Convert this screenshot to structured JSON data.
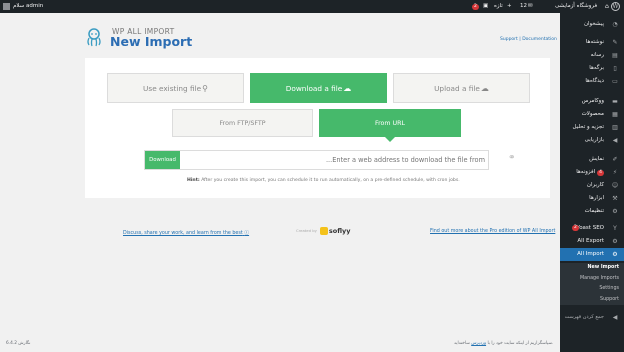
{
  "adminbar": {
    "user": "سلام admin",
    "site_name": "فروشگاه آزمایشی",
    "comments_count": "12",
    "new_label": "تازه",
    "updates_badge": "2"
  },
  "sidebar": {
    "items": [
      {
        "label": "پیشخوان",
        "icon": "dashboard-icon"
      },
      {
        "label": "نوشته‌ها",
        "icon": "pin-icon"
      },
      {
        "label": "رسانه",
        "icon": "media-icon"
      },
      {
        "label": "برگه‌ها",
        "icon": "pages-icon"
      },
      {
        "label": "دیدگاه‌ها",
        "icon": "comments-icon"
      },
      {
        "label": "ووکامرس",
        "icon": "woo-icon"
      },
      {
        "label": "محصولات",
        "icon": "products-icon"
      },
      {
        "label": "تجزیه و تحلیل",
        "icon": "analytics-icon"
      },
      {
        "label": "بازاریابی",
        "icon": "megaphone-icon"
      },
      {
        "label": "نمایش",
        "icon": "brush-icon"
      },
      {
        "label": "افزونه‌ها",
        "icon": "plugin-icon",
        "badge": "4"
      },
      {
        "label": "کاربران",
        "icon": "users-icon"
      },
      {
        "label": "ابزارها",
        "icon": "tools-icon"
      },
      {
        "label": "تنظیمات",
        "icon": "settings-icon"
      },
      {
        "label": "Yoast SEO",
        "icon": "yoast-icon",
        "badge": "2"
      },
      {
        "label": "All Export",
        "icon": "export-icon"
      },
      {
        "label": "All Import",
        "icon": "import-icon"
      }
    ],
    "submenu": [
      "New Import",
      "Manage Imports",
      "Settings",
      "Support"
    ],
    "collapse": "جمع کردن فهرست"
  },
  "header": {
    "logo_small": "WP ALL IMPORT",
    "logo_big": "New Import",
    "support_link": "Support",
    "separator": "|",
    "documentation_link": "Documentation"
  },
  "options": {
    "existing": "Use existing file",
    "download": "Download a file",
    "upload": "Upload a file"
  },
  "tabs": {
    "ftp": "From FTP/SFTP",
    "url": "From URL"
  },
  "url_field": {
    "button": "Download",
    "placeholder": "Enter a web address to download the file from..."
  },
  "hint": {
    "bold": "Hint:",
    "text": "After you create this import, you can schedule it to run automatically, on a pre-defined schedule, with cron jobs."
  },
  "footer": {
    "discuss": "Discuss, share your work, and learn from the best",
    "created_by": "Created by",
    "brand": "soflyy",
    "pro": "Find out more about the Pro edition of WP All Import",
    "wp_left": "نگارش 6.4.2",
    "wp_right_pre": "سپاسگزاریم از اینکه سایت خود را با",
    "wp_right_link": "وردپرس",
    "wp_right_post": "ساخته‌اید."
  },
  "colors": {
    "accent_green": "#46b96b",
    "admin_dark": "#1d2327",
    "wp_blue": "#2271b1"
  }
}
